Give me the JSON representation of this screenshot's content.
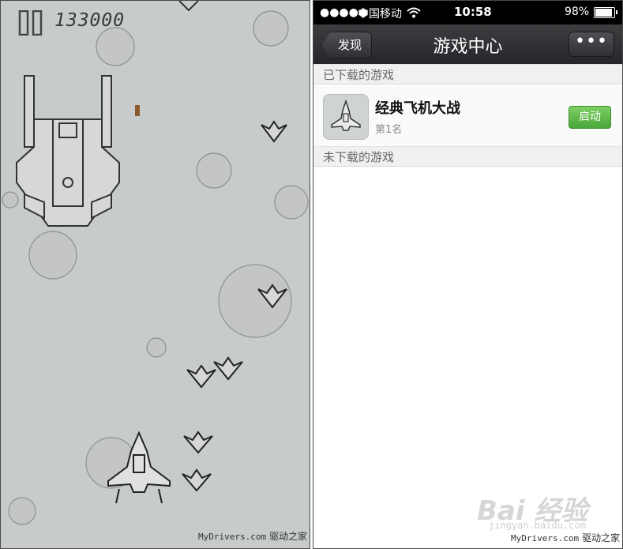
{
  "game": {
    "score": "133000",
    "watermark": "MyDrivers.com",
    "watermark_cn": "驱动之家"
  },
  "phone": {
    "status": {
      "signal": "●●●●●",
      "carrier": "中国移动",
      "time": "10:58",
      "battery": "98%"
    },
    "nav": {
      "back_label": "发现",
      "title": "游戏中心",
      "more_label": "•••"
    },
    "sections": {
      "downloaded": "已下载的游戏",
      "not_downloaded": "未下载的游戏"
    },
    "games": [
      {
        "name": "经典飞机大战",
        "rank": "第1名",
        "action": "启动"
      }
    ],
    "watermark_baidu": "Bai 经验",
    "watermark_baidu_sub": "jingyan.baidu.com",
    "watermark": "MyDrivers.com",
    "watermark_cn": "驱动之家"
  },
  "colors": {
    "game_bg": "#c8cbcc",
    "nav_bg": "#2f3034",
    "launch_green": "#5cb84a"
  }
}
